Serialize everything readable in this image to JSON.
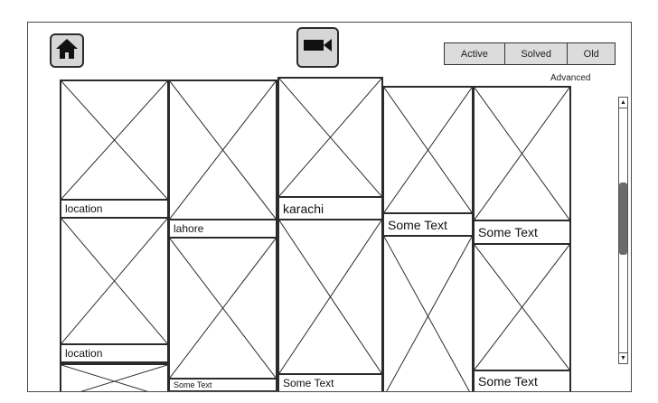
{
  "toolbar": {
    "home_icon": "home-icon",
    "video_icon": "video-camera-icon"
  },
  "filters": {
    "tabs": [
      "Active",
      "Solved",
      "Old"
    ],
    "advanced_label": "Advanced"
  },
  "grid": {
    "captions": {
      "c1_top": "location",
      "c1_bottom": "location",
      "c2_top": "lahore",
      "c2_bottom": "Some Text",
      "c3_top": "karachi",
      "c3_bottom": "Some Text",
      "c4_top": "Some Text",
      "c5_top": "Some Text",
      "c5_bottom": "Some Text"
    }
  },
  "scrollbar": {
    "up_glyph": "▲",
    "down_glyph": "▼"
  },
  "colors": {
    "frame_border": "#4a4a4a",
    "button_fill": "#d6d6d6",
    "tab_fill": "#dcdcdc",
    "scroll_thumb": "#6b6b6b"
  }
}
